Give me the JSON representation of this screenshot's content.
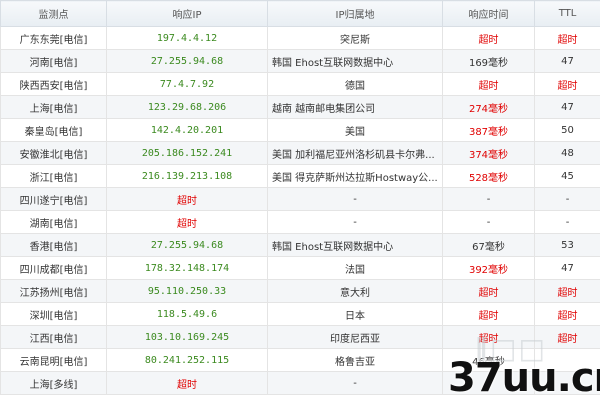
{
  "headers": [
    "监测点",
    "响应IP",
    "IP归属地",
    "响应时间",
    "TTL"
  ],
  "rows": [
    {
      "node": "广东东莞[电信]",
      "ip": "197.4.4.12",
      "location": "突尼斯",
      "time": "超时",
      "ttl": "超时"
    },
    {
      "node": "河南[电信]",
      "ip": "27.255.94.68",
      "location": "韩国 Ehost互联网数据中心",
      "time": "169毫秒",
      "ttl": "47"
    },
    {
      "node": "陕西西安[电信]",
      "ip": "77.4.7.92",
      "location": "德国",
      "time": "超时",
      "ttl": "超时"
    },
    {
      "node": "上海[电信]",
      "ip": "123.29.68.206",
      "location": "越南 越南邮电集团公司",
      "time": "274毫秒",
      "ttl": "47"
    },
    {
      "node": "秦皇岛[电信]",
      "ip": "142.4.20.201",
      "location": "美国",
      "time": "387毫秒",
      "ttl": "50"
    },
    {
      "node": "安徽淮北[电信]",
      "ip": "205.186.152.241",
      "location": "美国 加利福尼亚州洛杉矶县卡尔弗...",
      "time": "374毫秒",
      "ttl": "48"
    },
    {
      "node": "浙江[电信]",
      "ip": "216.139.213.108",
      "location": "美国 得克萨斯州达拉斯Hostway公...",
      "time": "528毫秒",
      "ttl": "45"
    },
    {
      "node": "四川遂宁[电信]",
      "ip": "超时",
      "location": "-",
      "time": "-",
      "ttl": "-"
    },
    {
      "node": "湖南[电信]",
      "ip": "超时",
      "location": "-",
      "time": "-",
      "ttl": "-"
    },
    {
      "node": "香港[电信]",
      "ip": "27.255.94.68",
      "location": "韩国 Ehost互联网数据中心",
      "time": "67毫秒",
      "ttl": "53"
    },
    {
      "node": "四川成都[电信]",
      "ip": "178.32.148.174",
      "location": "法国",
      "time": "392毫秒",
      "ttl": "47"
    },
    {
      "node": "江苏扬州[电信]",
      "ip": "95.110.250.33",
      "location": "意大利",
      "time": "超时",
      "ttl": "超时"
    },
    {
      "node": "深圳[电信]",
      "ip": "118.5.49.6",
      "location": "日本",
      "time": "超时",
      "ttl": "超时"
    },
    {
      "node": "江西[电信]",
      "ip": "103.10.169.245",
      "location": "印度尼西亚",
      "time": "超时",
      "ttl": "超时"
    },
    {
      "node": "云南昆明[电信]",
      "ip": "80.241.252.115",
      "location": "格鲁吉亚",
      "time": "46毫秒",
      "ttl": ""
    },
    {
      "node": "上海[多线]",
      "ip": "超时",
      "location": "-",
      "time": "",
      "ttl": ""
    }
  ],
  "watermark": {
    "logo": "37uu.cn"
  },
  "colors": {
    "ip_green": "#3b8a1f",
    "timeout_red": "#e00000",
    "header_bg": "#e8eef3"
  }
}
